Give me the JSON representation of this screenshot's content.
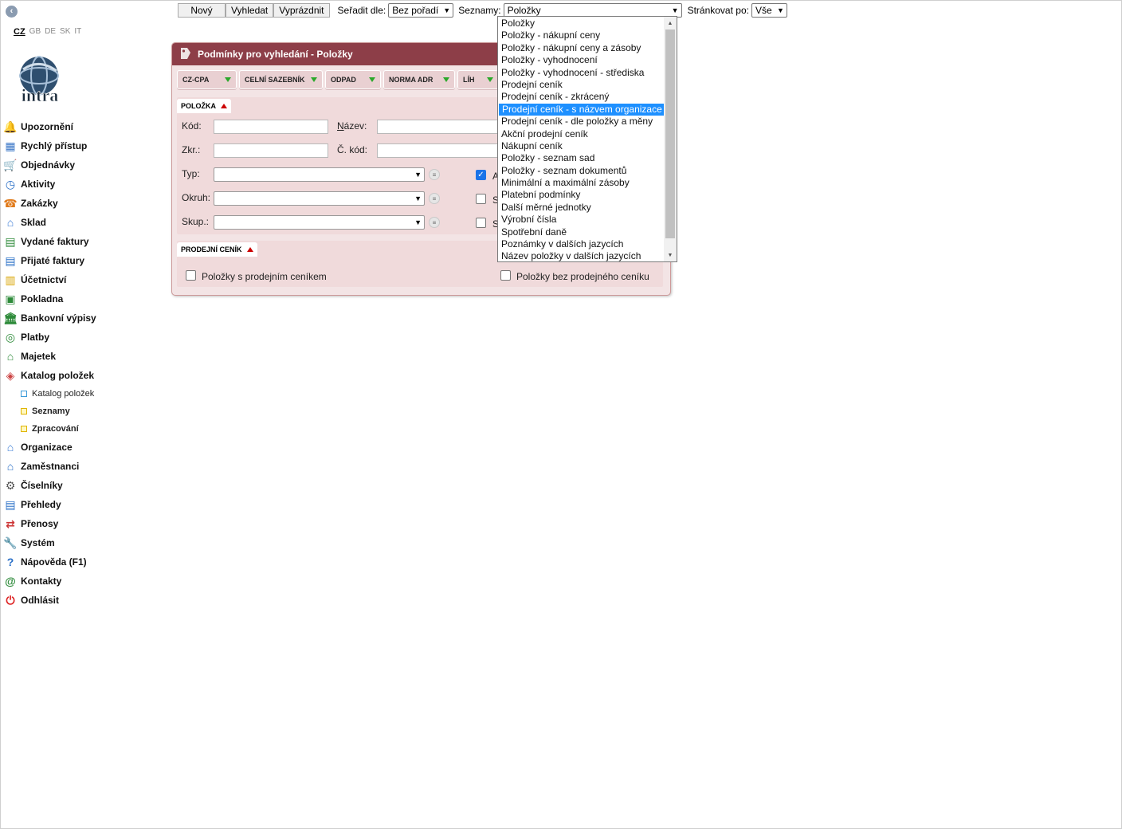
{
  "sidebar": {
    "collapse_glyph": "‹",
    "languages": [
      "CZ",
      "GB",
      "DE",
      "SK",
      "IT"
    ],
    "logo_text": "intra",
    "items": [
      {
        "label": "Upozornění",
        "icon": "bell-icon",
        "color": "#e8a317"
      },
      {
        "label": "Rychlý přístup",
        "icon": "grid-icon",
        "color": "#3c78c8"
      },
      {
        "label": "Objednávky",
        "icon": "cart-icon",
        "color": "#2e8b3a"
      },
      {
        "label": "Aktivity",
        "icon": "clock-icon",
        "color": "#2a6fc7"
      },
      {
        "label": "Zakázky",
        "icon": "phone-icon",
        "color": "#e07a1a"
      },
      {
        "label": "Sklad",
        "icon": "house-icon",
        "color": "#3a7bd5"
      },
      {
        "label": "Vydané faktury",
        "icon": "invoice-out-icon",
        "color": "#2e8b3a"
      },
      {
        "label": "Přijaté faktury",
        "icon": "invoice-in-icon",
        "color": "#2a6fc7"
      },
      {
        "label": "Účetnictví",
        "icon": "ledger-icon",
        "color": "#d9a400"
      },
      {
        "label": "Pokladna",
        "icon": "cashbox-icon",
        "color": "#2e8b3a"
      },
      {
        "label": "Bankovní výpisy",
        "icon": "bank-icon",
        "color": "#2e8b3a"
      },
      {
        "label": "Platby",
        "icon": "payment-icon",
        "color": "#2e8b3a"
      },
      {
        "label": "Majetek",
        "icon": "building-icon",
        "color": "#2e8b3a"
      },
      {
        "label": "Katalog položek",
        "icon": "tag-icon",
        "color": "#c44"
      }
    ],
    "subitems": [
      "Katalog položek",
      "Seznamy",
      "Zpracování"
    ],
    "items2": [
      {
        "label": "Organizace",
        "icon": "org-icon",
        "color": "#3a7bd5"
      },
      {
        "label": "Zaměstnanci",
        "icon": "employees-icon",
        "color": "#2a6fc7"
      },
      {
        "label": "Číselníky",
        "icon": "gear-icon",
        "color": "#555"
      },
      {
        "label": "Přehledy",
        "icon": "report-icon",
        "color": "#2a6fc7"
      },
      {
        "label": "Přenosy",
        "icon": "transfer-icon",
        "color": "#c33"
      },
      {
        "label": "Systém",
        "icon": "wrench-icon",
        "color": "#777"
      },
      {
        "label": "Nápověda (F1)",
        "icon": "help-icon",
        "color": "#2a6fc7"
      },
      {
        "label": "Kontakty",
        "icon": "at-icon",
        "color": "#2e8b3a"
      },
      {
        "label": "Odhlásit",
        "icon": "power-icon",
        "color": "#d22"
      }
    ]
  },
  "toolbar": {
    "new_label": "Nový",
    "search_label": "Vyhledat",
    "clear_label": "Vyprázdnit",
    "sort_label": "Seřadit dle:",
    "sort_value": "Bez pořadí",
    "lists_label": "Seznamy:",
    "lists_value": "Položky",
    "paging_label": "Stránkovat po:",
    "paging_value": "Vše"
  },
  "panel": {
    "title": "Podmínky pro vyhledání - Položky",
    "tabs": [
      "CZ-CPA",
      "CELNÍ SAZEBNÍK",
      "ODPAD",
      "NORMA ADR",
      "LÍH"
    ],
    "section1": "POLOŽKA",
    "labels": {
      "kod": "Kód:",
      "nazev_pre": "N",
      "nazev_post": "ázev:",
      "zkr": "Zkr.:",
      "ckod": "Č. kód:",
      "typ": "Typ:",
      "okruh": "Okruh:",
      "skup": "Skup.:"
    },
    "partial_labels": [
      "A",
      "S",
      "S"
    ],
    "section2": "PRODEJNÍ CENÍK",
    "check_with": "Položky s prodejním ceníkem",
    "check_without": "Položky bez prodejného ceníku",
    "list_icon": "≡"
  },
  "dropdown": {
    "options": [
      "Položky",
      "Položky - nákupní ceny",
      "Položky - nákupní ceny a zásoby",
      "Položky - vyhodnocení",
      "Položky - vyhodnocení - střediska",
      "Prodejní ceník",
      "Prodejní ceník - zkrácený",
      "Prodejní ceník - s názvem organizace",
      "Prodejní ceník - dle položky a měny",
      "Akční prodejní ceník",
      "Nákupní ceník",
      "Položky - seznam sad",
      "Položky - seznam dokumentů",
      "Minimální a maximální zásoby",
      "Platební podmínky",
      "Další měrné jednotky",
      "Výrobní čísla",
      "Spotřební daně",
      "Poznámky v dalších jazycích",
      "Název položky v dalších jazycích"
    ],
    "selected_index": 7
  },
  "colors": {
    "panel_header": "#8d3e48",
    "panel_bg": "#f3e4e5",
    "highlight": "#1e90ff",
    "tab_arrow": "#2aa82a",
    "section_arrow": "#cc0000"
  }
}
